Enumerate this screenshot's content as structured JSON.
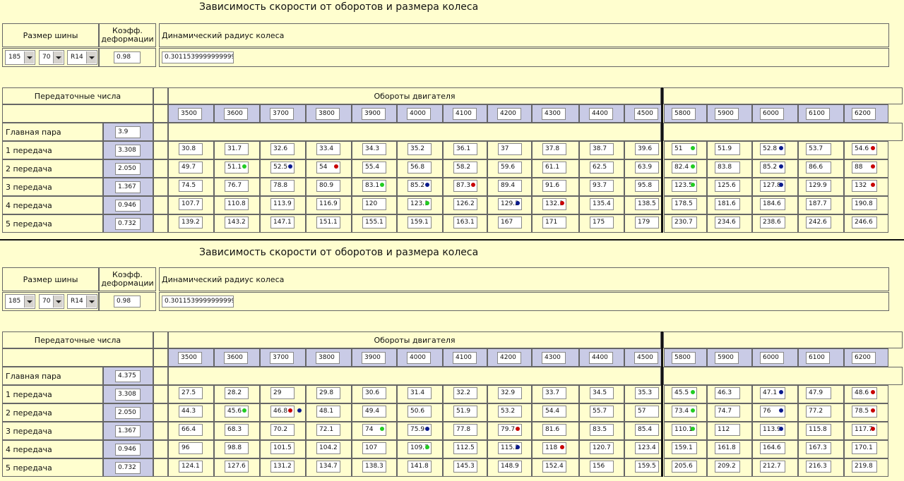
{
  "labels": {
    "title": "Зависимость скорости от оборотов и размера колеса",
    "tire_size": "Размер шины",
    "coef_line1": "Коэфф.",
    "coef_line2": "деформации",
    "dyn_radius": "Динамический радиус колеса",
    "gear_ratios": "Передаточные числа",
    "engine_rpm": "Обороты двигателя",
    "main_pair": "Главная пара",
    "gears": [
      "1 передача",
      "2 передача",
      "3 передача",
      "4 передача",
      "5 передача"
    ]
  },
  "colors": {
    "green": "#22cc22",
    "blue": "#0a1a8c",
    "red": "#c80000",
    "band": "#c9cbe6",
    "bg": "#fffecf"
  },
  "rpm_left": [
    "3500",
    "3600",
    "3700",
    "3800",
    "3900",
    "4000",
    "4100",
    "4200",
    "4300",
    "4400",
    "4500"
  ],
  "rpm_right": [
    "5800",
    "5900",
    "6000",
    "6100",
    "6200"
  ],
  "panels": [
    {
      "tire_width": "185",
      "tire_profile": "70",
      "tire_rim": "R14",
      "coef": "0.98",
      "radius": "0.30115399999999999",
      "main_pair": "3.9",
      "ratios": [
        "3.308",
        "2.050",
        "1.367",
        "0.946",
        "0.732"
      ],
      "speeds_left": [
        [
          "30.8",
          "31.7",
          "32.6",
          "33.4",
          "34.3",
          "35.2",
          "36.1",
          "37",
          "37.8",
          "38.7",
          "39.6"
        ],
        [
          "49.7",
          "51.1",
          "52.5",
          "54",
          "55.4",
          "56.8",
          "58.2",
          "59.6",
          "61.1",
          "62.5",
          "63.9"
        ],
        [
          "74.5",
          "76.7",
          "78.8",
          "80.9",
          "83.1",
          "85.2",
          "87.3",
          "89.4",
          "91.6",
          "93.7",
          "95.8"
        ],
        [
          "107.7",
          "110.8",
          "113.9",
          "116.9",
          "120",
          "123.1",
          "126.2",
          "129.2",
          "132.3",
          "135.4",
          "138.5"
        ],
        [
          "139.2",
          "143.2",
          "147.1",
          "151.1",
          "155.1",
          "159.1",
          "163.1",
          "167",
          "171",
          "175",
          "179"
        ]
      ],
      "speeds_right": [
        [
          "51",
          "51.9",
          "52.8",
          "53.7",
          "54.6"
        ],
        [
          "82.4",
          "83.8",
          "85.2",
          "86.6",
          "88"
        ],
        [
          "123.5",
          "125.6",
          "127.8",
          "129.9",
          "132"
        ],
        [
          "178.5",
          "181.6",
          "184.6",
          "187.7",
          "190.8"
        ],
        [
          "230.7",
          "234.6",
          "238.6",
          "242.6",
          "246.6"
        ]
      ],
      "dots_left": [
        [
          null,
          null,
          null,
          null,
          null,
          null,
          null,
          null,
          null,
          null,
          null
        ],
        [
          null,
          "g",
          "b",
          "r",
          null,
          null,
          null,
          null,
          null,
          null,
          null
        ],
        [
          null,
          null,
          null,
          null,
          "g",
          "b",
          "r",
          null,
          null,
          null,
          null
        ],
        [
          null,
          null,
          null,
          null,
          null,
          "g",
          null,
          "b",
          "r",
          null,
          null
        ],
        [
          null,
          null,
          null,
          null,
          null,
          null,
          null,
          null,
          null,
          null,
          null
        ]
      ],
      "dots_right": [
        [
          "g",
          null,
          "b",
          null,
          "r"
        ],
        [
          "g",
          null,
          "b",
          null,
          "r"
        ],
        [
          "g",
          null,
          "b",
          null,
          "r"
        ],
        [
          null,
          null,
          null,
          null,
          null
        ],
        [
          null,
          null,
          null,
          null,
          null
        ]
      ]
    },
    {
      "tire_width": "185",
      "tire_profile": "70",
      "tire_rim": "R14",
      "coef": "0.98",
      "radius": "0.30115399999999999",
      "main_pair": "4.375",
      "ratios": [
        "3.308",
        "2.050",
        "1.367",
        "0.946",
        "0.732"
      ],
      "speeds_left": [
        [
          "27.5",
          "28.2",
          "29",
          "29.8",
          "30.6",
          "31.4",
          "32.2",
          "32.9",
          "33.7",
          "34.5",
          "35.3"
        ],
        [
          "44.3",
          "45.6",
          "46.8",
          "48.1",
          "49.4",
          "50.6",
          "51.9",
          "53.2",
          "54.4",
          "55.7",
          "57"
        ],
        [
          "66.4",
          "68.3",
          "70.2",
          "72.1",
          "74",
          "75.9",
          "77.8",
          "79.7",
          "81.6",
          "83.5",
          "85.4"
        ],
        [
          "96",
          "98.8",
          "101.5",
          "104.2",
          "107",
          "109.7",
          "112.5",
          "115.2",
          "118",
          "120.7",
          "123.4"
        ],
        [
          "124.1",
          "127.6",
          "131.2",
          "134.7",
          "138.3",
          "141.8",
          "145.3",
          "148.9",
          "152.4",
          "156",
          "159.5"
        ]
      ],
      "speeds_right": [
        [
          "45.5",
          "46.3",
          "47.1",
          "47.9",
          "48.6"
        ],
        [
          "73.4",
          "74.7",
          "76",
          "77.2",
          "78.5"
        ],
        [
          "110.1",
          "112",
          "113.9",
          "115.8",
          "117.7"
        ],
        [
          "159.1",
          "161.8",
          "164.6",
          "167.3",
          "170.1"
        ],
        [
          "205.6",
          "209.2",
          "212.7",
          "216.3",
          "219.8"
        ]
      ],
      "dots_left": [
        [
          null,
          null,
          null,
          null,
          null,
          null,
          null,
          null,
          null,
          null,
          null
        ],
        [
          null,
          "g",
          "r",
          null,
          null,
          null,
          null,
          null,
          null,
          null,
          null
        ],
        [
          null,
          null,
          null,
          null,
          "g",
          "b",
          null,
          "r",
          null,
          null,
          null
        ],
        [
          null,
          null,
          null,
          null,
          null,
          "g",
          null,
          "b",
          "r",
          null,
          null
        ],
        [
          null,
          null,
          null,
          null,
          null,
          null,
          null,
          null,
          null,
          null,
          null
        ]
      ],
      "dots_right": [
        [
          "g",
          null,
          "b",
          null,
          "r"
        ],
        [
          "g",
          null,
          "b",
          null,
          "r"
        ],
        [
          "g",
          null,
          "b",
          null,
          "r"
        ],
        [
          null,
          null,
          null,
          null,
          null
        ],
        [
          null,
          null,
          null,
          null,
          null
        ]
      ],
      "extra_dots": [
        {
          "row": 1,
          "col": 2,
          "color": "b"
        }
      ]
    }
  ]
}
